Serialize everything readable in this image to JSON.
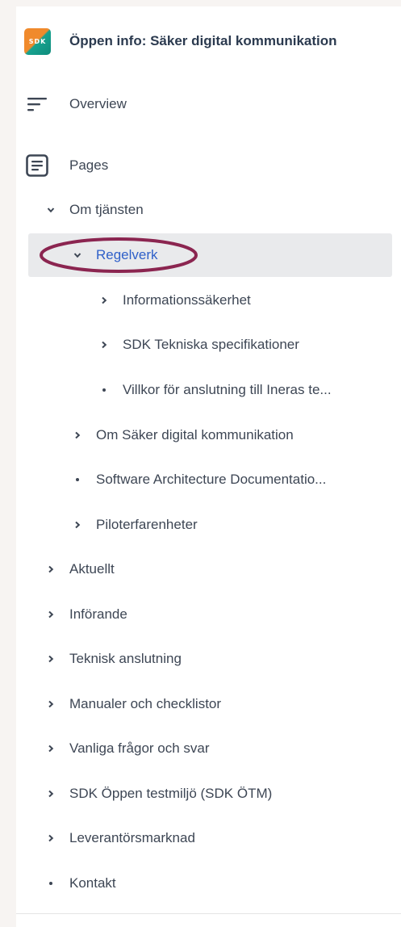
{
  "space": {
    "logo_text": "SDK",
    "title": "Öppen info: Säker digital kommunikation"
  },
  "nav": {
    "overview_label": "Overview",
    "pages_label": "Pages"
  },
  "tree": [
    {
      "label": "Om tjänsten",
      "marker": "chevron-down"
    },
    {
      "label": "Regelverk",
      "marker": "chevron-down",
      "selected": true
    },
    {
      "label": "Informationssäkerhet",
      "marker": "chevron-right"
    },
    {
      "label": "SDK Tekniska specifikationer",
      "marker": "chevron-right"
    },
    {
      "label": "Villkor för anslutning till Ineras te...",
      "marker": "bullet"
    },
    {
      "label": "Om Säker digital kommunikation",
      "marker": "chevron-right"
    },
    {
      "label": "Software Architecture Documentatio...",
      "marker": "bullet"
    },
    {
      "label": "Piloterfarenheter",
      "marker": "chevron-right"
    },
    {
      "label": "Aktuellt",
      "marker": "chevron-right"
    },
    {
      "label": "Införande",
      "marker": "chevron-right"
    },
    {
      "label": "Teknisk anslutning",
      "marker": "chevron-right"
    },
    {
      "label": "Manualer och checklistor",
      "marker": "chevron-right"
    },
    {
      "label": "Vanliga frågor och svar",
      "marker": "chevron-right"
    },
    {
      "label": "SDK Öppen testmiljö (SDK ÖTM)",
      "marker": "chevron-right"
    },
    {
      "label": "Leverantörsmarknad",
      "marker": "chevron-right"
    },
    {
      "label": "Kontakt",
      "marker": "bullet"
    }
  ],
  "colors": {
    "selected_text": "#2f60c9",
    "highlight_ring": "#8b2550"
  }
}
